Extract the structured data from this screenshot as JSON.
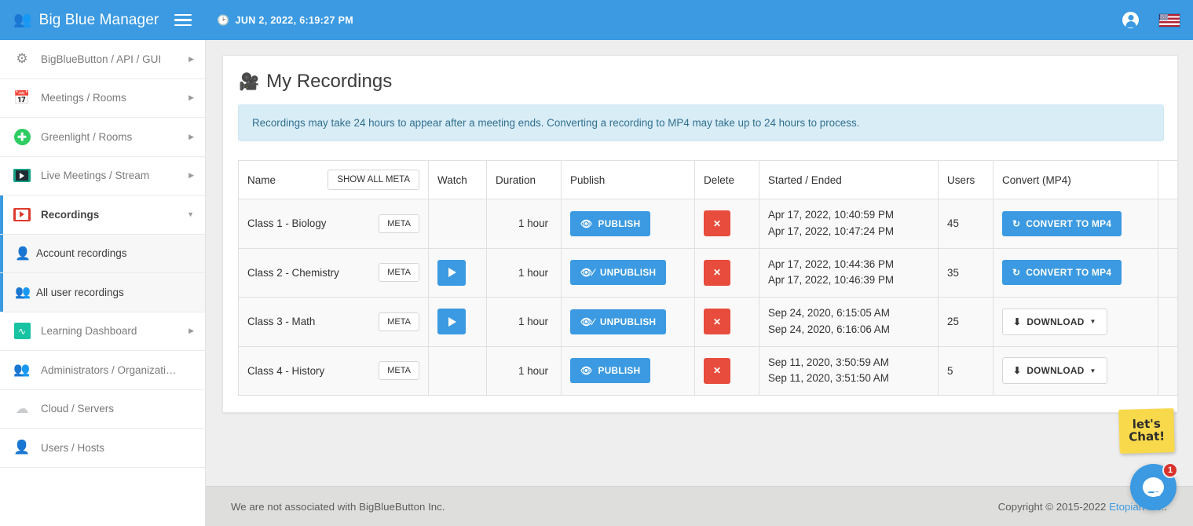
{
  "topbar": {
    "brand": "Big Blue Manager",
    "brand_icon": "users-icon",
    "menu_icon": "hamburger-icon",
    "datetime": "JUN 2, 2022, 6:19:27 PM",
    "clock_icon": "clock-icon",
    "account_icon": "user-circle-icon",
    "language_icon": "us-flag-icon",
    "accent_color": "#3b9ae1"
  },
  "sidebar": {
    "items": [
      {
        "label": "BigBlueButton / API / GUI",
        "icon": "gears-icon",
        "has_caret": true
      },
      {
        "label": "Meetings / Rooms",
        "icon": "calendar-clock-icon",
        "has_caret": true
      },
      {
        "label": "Greenlight / Rooms",
        "icon": "plus-circle-icon",
        "has_caret": true
      },
      {
        "label": "Live Meetings / Stream",
        "icon": "film-play-green-icon",
        "has_caret": true
      },
      {
        "label": "Recordings",
        "icon": "film-play-red-icon",
        "has_caret": true,
        "expanded": true,
        "active": true
      },
      {
        "label": "Learning Dashboard",
        "icon": "activity-dashboard-icon",
        "has_caret": true
      },
      {
        "label": "Administrators / Organizati…",
        "icon": "admins-icon",
        "has_caret": false
      },
      {
        "label": "Cloud / Servers",
        "icon": "cloud-icon",
        "has_caret": false
      },
      {
        "label": "Users / Hosts",
        "icon": "user-icon",
        "has_caret": false
      }
    ],
    "sub_items": [
      {
        "label": "Account recordings",
        "icon": "user-icon"
      },
      {
        "label": "All user recordings",
        "icon": "users-group-icon",
        "active": true
      }
    ]
  },
  "page": {
    "title": "My Recordings",
    "title_icon": "film-icon",
    "alert": "Recordings may take 24 hours to appear after a meeting ends. Converting a recording to MP4 may take up to 24 hours to process."
  },
  "table": {
    "headers": {
      "name": "Name",
      "show_all_meta": "SHOW ALL META",
      "watch": "Watch",
      "duration": "Duration",
      "publish": "Publish",
      "delete": "Delete",
      "dates": "Started / Ended",
      "users": "Users",
      "convert": "Convert (MP4)"
    },
    "meta_label": "META",
    "rows": [
      {
        "name": "Class 1 - Biology",
        "watch": null,
        "duration": "1 hour",
        "publish_label": "PUBLISH",
        "publish_state": "unpublished",
        "publish_icon": "eye-icon",
        "delete_icon": "close-icon",
        "started": "Apr 17, 2022, 10:40:59 PM",
        "ended": "Apr 17, 2022, 10:47:24 PM",
        "users": "45",
        "convert_label": "CONVERT TO MP4",
        "convert_type": "convert",
        "convert_icon": "refresh-icon"
      },
      {
        "name": "Class 2 - Chemistry",
        "watch": "play-icon",
        "duration": "1 hour",
        "publish_label": "UNPUBLISH",
        "publish_state": "published",
        "publish_icon": "eye-slash-icon",
        "delete_icon": "close-icon",
        "started": "Apr 17, 2022, 10:44:36 PM",
        "ended": "Apr 17, 2022, 10:46:39 PM",
        "users": "35",
        "convert_label": "CONVERT TO MP4",
        "convert_type": "convert",
        "convert_icon": "refresh-icon"
      },
      {
        "name": "Class 3 - Math",
        "watch": "play-icon",
        "duration": "1 hour",
        "publish_label": "UNPUBLISH",
        "publish_state": "published",
        "publish_icon": "eye-slash-icon",
        "delete_icon": "close-icon",
        "started": "Sep 24, 2020, 6:15:05 AM",
        "ended": "Sep 24, 2020, 6:16:06 AM",
        "users": "25",
        "convert_label": "DOWNLOAD",
        "convert_type": "download",
        "convert_icon": "download-icon"
      },
      {
        "name": "Class 4 - History",
        "watch": null,
        "duration": "1 hour",
        "publish_label": "PUBLISH",
        "publish_state": "unpublished",
        "publish_icon": "eye-icon",
        "delete_icon": "close-icon",
        "started": "Sep 11, 2020, 3:50:59 AM",
        "ended": "Sep 11, 2020, 3:51:50 AM",
        "users": "5",
        "convert_label": "DOWNLOAD",
        "convert_type": "download",
        "convert_icon": "download-icon"
      }
    ]
  },
  "footer": {
    "left": "We are not associated with BigBlueButton Inc.",
    "copyright": "Copyright © 2015-2022",
    "link": "Etopian Inc.",
    "link_suffix": "."
  },
  "chat": {
    "note_line1": "let's",
    "note_line2": "Chat!",
    "badge": "1",
    "bubble_icon": "chat-bubble-icon",
    "bubble_color": "#3b9ae1",
    "note_color": "#f8d94b"
  }
}
